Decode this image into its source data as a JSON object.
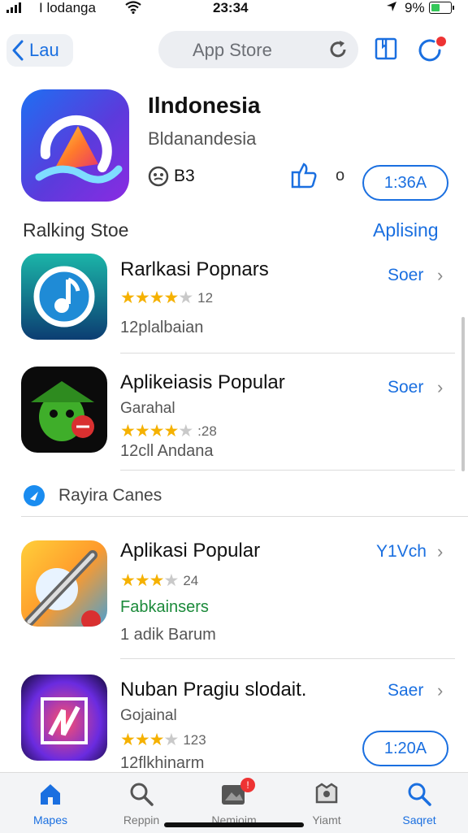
{
  "status": {
    "carrier": "I lodanga",
    "time": "23:34",
    "battery": "9%"
  },
  "nav": {
    "back_label": "Lau",
    "search_label": "App Store"
  },
  "hero": {
    "title": "Ilndonesia",
    "subtitle": "Bldanandesia",
    "rating": "B3",
    "dot": "o",
    "button": "1:36A"
  },
  "section1": {
    "title": "Ralking Stoe",
    "link": "Aplising"
  },
  "rows": [
    {
      "title": "Rarlkasi Popnars",
      "stars": 4,
      "count": "12",
      "meta": "12plalbaian",
      "action": "Soer"
    },
    {
      "title": "Aplikeiasis Popular",
      "sub": "Garahal",
      "stars": 4,
      "count": ":28",
      "meta": "12cll Andana",
      "action": "Soer"
    },
    {
      "title": "Aplikasi Popular",
      "stars": 3,
      "count": "24",
      "green": "Fabkainsers",
      "meta": "1 adik Barum",
      "action": "Y1Vch"
    },
    {
      "title": "Nuban Pragiu slodait.",
      "sub": "Gojainal",
      "stars": 3,
      "count": "123",
      "meta": "12flkhinarm",
      "action": "Saer",
      "button": "1:20A"
    }
  ],
  "promo": {
    "label": "Rayira Canes"
  },
  "tabs": [
    {
      "label": "Mapes"
    },
    {
      "label": "Reppin"
    },
    {
      "label": "Nemioim",
      "badge": "!"
    },
    {
      "label": "Yiamt"
    },
    {
      "label": "Saqret"
    }
  ],
  "colors": {
    "accent": "#1a6fe0",
    "star": "#f5b100",
    "green": "#1b8a3a",
    "badge": "#e33333"
  }
}
